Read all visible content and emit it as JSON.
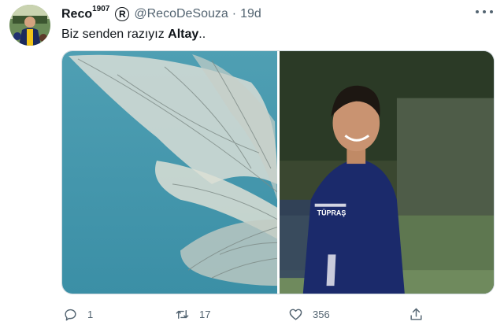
{
  "tweet": {
    "display_name": "Reco",
    "name_superscript": "1907",
    "badge_symbol": "R",
    "handle": "@RecoDeSouza",
    "separator": "·",
    "time": "19d",
    "text_before": "Biz senden razıyız ",
    "text_bold": "Altay",
    "text_after": "..",
    "jersey_text": "TÜPRAŞ"
  },
  "actions": {
    "reply_count": "1",
    "retweet_count": "17",
    "like_count": "356"
  },
  "icons": {
    "reply": "reply-icon",
    "retweet": "retweet-icon",
    "like": "heart-icon",
    "share": "share-icon",
    "more": "more-icon",
    "badge": "registered-badge-icon"
  },
  "colors": {
    "text": "#0f1419",
    "secondary": "#536471",
    "border": "#cfd9de"
  }
}
